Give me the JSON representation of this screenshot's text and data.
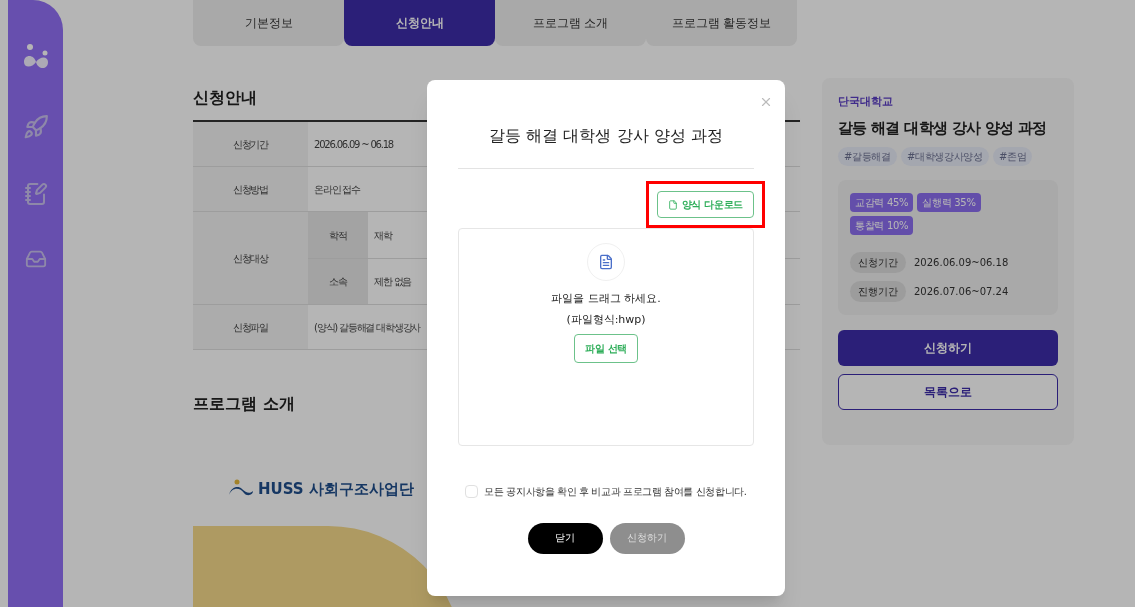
{
  "tabs": [
    {
      "label": "기본정보",
      "selected": false
    },
    {
      "label": "신청안내",
      "selected": true
    },
    {
      "label": "프로그램 소개",
      "selected": false
    },
    {
      "label": "프로그램 활동정보",
      "selected": false
    }
  ],
  "application_info": {
    "title": "신청안내",
    "rows": [
      {
        "label": "신청기간",
        "value": "2026.06.09 ~ 06.18"
      },
      {
        "label": "신청방법",
        "value": "온라인 접수"
      },
      {
        "label": "신청대상",
        "subrows": [
          {
            "label": "학적",
            "value": "재학"
          },
          {
            "label": "소속",
            "value": "제한 없음"
          }
        ]
      },
      {
        "label": "신청파일",
        "value": "(양식) 갈등해결 대학생강사"
      }
    ]
  },
  "program_intro": {
    "title": "프로그램 소개",
    "logo_text": "HUSS 사회구조사업단"
  },
  "course_card": {
    "university": "단국대학교",
    "title": "갈등 해결 대학생 강사 양성 과정",
    "hashtags": [
      "#갈등해결",
      "#대학생강사양성",
      "#존엄"
    ],
    "competencies": [
      "교감력 45%",
      "실행력 35%",
      "통찰력 10%"
    ],
    "periods": [
      {
        "label": "신청기간",
        "value": "2026.06.09~06.18"
      },
      {
        "label": "진행기간",
        "value": "2026.07.06~07.24"
      }
    ],
    "apply_button": "신청하기",
    "list_button": "목록으로"
  },
  "modal": {
    "title": "갈등 해결 대학생 강사 양성 과정",
    "download_button": "양식 다운로드",
    "highlighted": true,
    "dropzone": {
      "line1": "파일을 드래그 하세요.",
      "line2": "(파일형식:hwp)",
      "select_button": "파일 선택"
    },
    "consent": {
      "label": "모든 공지사항을 확인 후 비교과 프로그램 참여를 신청합니다.",
      "checked": false
    },
    "close_button": "닫기",
    "apply_button": {
      "label": "신청하기",
      "disabled": true
    }
  }
}
